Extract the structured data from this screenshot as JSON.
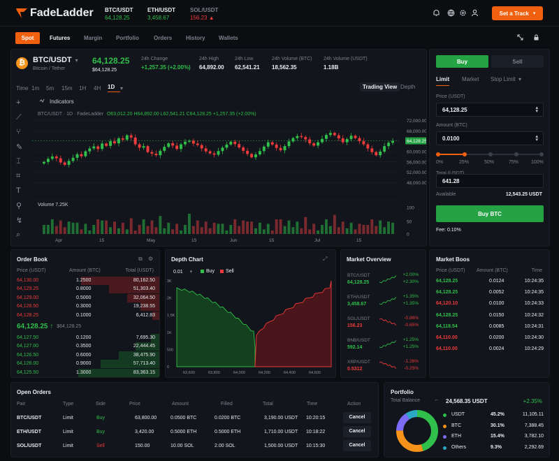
{
  "brand": {
    "name_a": "Fade",
    "name_b": "Ladder"
  },
  "tickers": [
    {
      "sym": "BTC/USDT",
      "price": "64,128.25",
      "color": "green"
    },
    {
      "sym": "ETH/USDT",
      "price": "3,458.67",
      "color": "green"
    },
    {
      "sym": "SOL/USDT",
      "price": "156.23 ▲",
      "color": "red"
    }
  ],
  "header": {
    "cta": "Set a Track"
  },
  "nav": [
    "Spot",
    "Futures",
    "Margin",
    "Portfolio",
    "Orders",
    "History",
    "Wallets"
  ],
  "market": {
    "pair": "BTC/USDT",
    "pair_sub": "Bitcoin / Tether",
    "last": "64,128.25",
    "last_sub": "$64,128.25",
    "stats": [
      {
        "label": "24h Change",
        "value": "+1,257.35 (+2.00%)",
        "color": "green"
      },
      {
        "label": "24h High",
        "value": "64,892.00",
        "color": "white"
      },
      {
        "label": "24h Low",
        "value": "62,541.21",
        "color": "white"
      },
      {
        "label": "24h Volume (BTC)",
        "value": "18,562.35",
        "color": "white"
      },
      {
        "label": "24h Volume (USDT)",
        "value": "1.18B",
        "color": "white"
      }
    ]
  },
  "chart_tabs": {
    "times": [
      "Time",
      "1m",
      "5m",
      "15m",
      "1H",
      "4H",
      "1D"
    ],
    "active_time": "1D",
    "more": "▾",
    "view_a": "Trading View",
    "view_b": "Depth",
    "indicators": "Indicators"
  },
  "chart_data": {
    "type": "candlestick",
    "ohlc_label": "BTC/USDT · 1D · FadeLadder",
    "ohlc_values": "O63,012.20  H64,892.00  L62,541.21  C64,128.25  +1,257.35 (+2.00%)",
    "y_ticks": [
      "72,000.00",
      "68,000.00",
      "64,128.25",
      "60,000.00",
      "56,000.00",
      "52,000.00",
      "48,000.00"
    ],
    "ylim": [
      46000,
      74000
    ],
    "current_price": 64128.25,
    "x_ticks": [
      "Apr",
      "15",
      "May",
      "15",
      "Jun",
      "15",
      "Jul",
      "15"
    ],
    "candles_close": [
      56000,
      57200,
      58100,
      57400,
      55800,
      54900,
      56400,
      57600,
      59000,
      58200,
      60100,
      61200,
      62000,
      61000,
      63100,
      62200,
      64000,
      63200,
      65100,
      64600,
      66300,
      65400,
      62800,
      61500,
      62100,
      59800,
      59200,
      58600,
      60300,
      61800,
      63200,
      62300,
      61000,
      62800,
      63800,
      64200,
      63100,
      62500,
      61200,
      60100,
      59300,
      58800,
      60200,
      61500,
      62700,
      63800,
      62900,
      61600,
      60300,
      59100,
      57800,
      58900,
      60200,
      61900,
      63600,
      62700,
      61400,
      60500,
      62100,
      63900,
      65200,
      66000,
      65600,
      64700,
      63200,
      62300,
      63600,
      64900,
      66400,
      67200,
      66300,
      65100,
      63600,
      64800,
      66100,
      65200,
      64000,
      62800,
      61200,
      59800,
      58600,
      60000,
      62100,
      63400,
      64128
    ],
    "volume_label": "Volume  7.25K",
    "volume_ticks": [
      "100",
      "50",
      "0"
    ]
  },
  "order_form": {
    "buy_tab": "Buy",
    "sell_tab": "Sell",
    "types": [
      "Limit",
      "Market",
      "Stop Limit"
    ],
    "price_label": "Price (USDT)",
    "price": "64,128.25",
    "amount_label": "Amount (BTC)",
    "amount": "0.0100",
    "slider": [
      "0%",
      "25%",
      "50%",
      "75%",
      "100%"
    ],
    "slider_level": 0.25,
    "total_label": "Total (USDT)",
    "total": "641.28",
    "available_label": "Available",
    "available": "12,543.25 USDT",
    "submit": "Buy BTC",
    "fee": "Fee: 0.10%"
  },
  "order_book": {
    "title": "Order Book",
    "cols": [
      "Price (USDT)",
      "Amount (BTC)",
      "Total (USDT)"
    ],
    "asks": [
      [
        "64,130.00",
        "1.2500",
        "80,162.50",
        0.95
      ],
      [
        "64,129.25",
        "0.8000",
        "51,303.40",
        0.62
      ],
      [
        "64,129.00",
        "0.5000",
        "32,064.50",
        0.4
      ],
      [
        "64,128.50",
        "0.3000",
        "19,238.55",
        0.24
      ],
      [
        "64,128.25",
        "0.1000",
        "6,412.83",
        0.1
      ]
    ],
    "mid": "64,128.25 ↑",
    "mid_sub": "$64,128.25",
    "bids": [
      [
        "64,127.50",
        "0.1200",
        "7,695.30",
        0.12
      ],
      [
        "64,127.00",
        "0.3500",
        "22,444.45",
        0.3
      ],
      [
        "64,126.50",
        "0.6000",
        "38,475.90",
        0.5
      ],
      [
        "64,126.00",
        "0.9000",
        "57,713.40",
        0.72
      ],
      [
        "64,125.50",
        "1.3000",
        "83,363.15",
        0.98
      ]
    ]
  },
  "depth": {
    "title": "Depth Chart",
    "step": "0.01",
    "buy": "Buy",
    "sell": "Sell",
    "y_ticks": [
      "3K",
      "2K",
      "1.5K",
      "1K",
      "500",
      "0"
    ],
    "x_ticks": [
      "63,600",
      "63,800",
      "64,000",
      "64,200",
      "64,400",
      "64,600"
    ]
  },
  "overview": {
    "title": "Market Overview",
    "items": [
      {
        "sym": "BTC/USDT",
        "price": "64,128.25",
        "c1": "+2.00%",
        "c2": "+2.30%",
        "color": "green"
      },
      {
        "sym": "ETH/USDT",
        "price": "3,458.67",
        "c1": "+1.35%",
        "c2": "+1.35%",
        "color": "green"
      },
      {
        "sym": "SOL/USDT",
        "price": "156.23",
        "c1": "-0.86%",
        "c2": "-0.65%",
        "color": "red"
      },
      {
        "sym": "BNB/USDT",
        "price": "592.14",
        "c1": "+1.25%",
        "c2": "+1.25%",
        "color": "green"
      },
      {
        "sym": "XRP/USDT",
        "price": "0.5312",
        "c1": "-1.26%",
        "c2": "-0.25%",
        "color": "red"
      }
    ]
  },
  "trades": {
    "title": "Market Boos",
    "cols": [
      "Price (USDT)",
      "Amount (BTC)",
      "Time"
    ],
    "rows": [
      [
        "64,128.25",
        "0.0124",
        "10:24:35",
        "green"
      ],
      [
        "64,128.25",
        "0.0052",
        "10:24:35",
        "green"
      ],
      [
        "64,120.10",
        "0.0100",
        "10:24:33",
        "red"
      ],
      [
        "64,128.25",
        "0.0150",
        "10:24:32",
        "green"
      ],
      [
        "64,118.54",
        "0.0085",
        "10:24:31",
        "green"
      ],
      [
        "64,110.00",
        "0.0200",
        "10:24:30",
        "red"
      ],
      [
        "64,110.00",
        "0.0024",
        "10:24:29",
        "red"
      ]
    ]
  },
  "open_orders": {
    "title": "Open Orders",
    "cols": [
      "Pair",
      "Type",
      "Side",
      "Price",
      "Amount",
      "Filled",
      "Total",
      "Time",
      "Action"
    ],
    "rows": [
      [
        "BTC/USDT",
        "Limit",
        "Buy",
        "63,800.00",
        "0.0500 BTC",
        "0.0200 BTC",
        "3,190.00 USDT",
        "10:20:15",
        "Cancel",
        "green"
      ],
      [
        "ETH/USDT",
        "Limit",
        "Buy",
        "3,420.00",
        "0.5000 ETH",
        "0.5000 ETH",
        "1,710.00 USDT",
        "10:18:22",
        "Cancel",
        "green"
      ],
      [
        "SOL/USDT",
        "Limit",
        "Sell",
        "150.00",
        "10.00 SOL",
        "2.00 SOL",
        "1,500.00 USDT",
        "10:15:30",
        "Cancel",
        "red"
      ]
    ]
  },
  "portfolio": {
    "title": "Portfolio",
    "balance_label": "Total Balance",
    "balance": "24,568.35 USDT",
    "change": "+2.35%",
    "assets": [
      {
        "name": "USDT",
        "pct": "45.2%",
        "value": "11,105.11",
        "color": "#2fbf4a",
        "frac": 0.452
      },
      {
        "name": "BTC",
        "pct": "30.1%",
        "value": "7,388.45",
        "color": "#f7931a",
        "frac": 0.301
      },
      {
        "name": "ETH",
        "pct": "15.4%",
        "value": "3,782.10",
        "color": "#7b6cf6",
        "frac": 0.154
      },
      {
        "name": "Others",
        "pct": "9.3%",
        "value": "2,292.69",
        "color": "#2aa8c4",
        "frac": 0.093
      }
    ]
  },
  "colors": {
    "accent": "#f0600f",
    "green": "#2fbf4a",
    "red": "#ef3b3b"
  }
}
